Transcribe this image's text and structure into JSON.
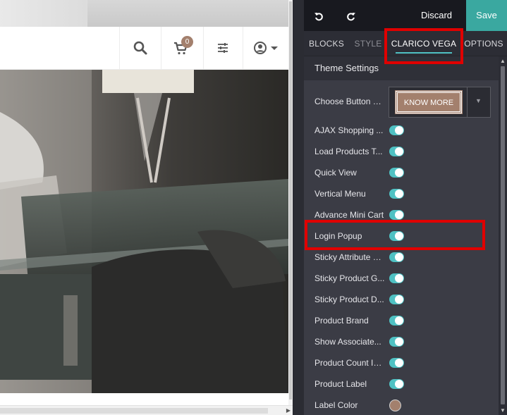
{
  "navbar": {
    "search_icon": "search-icon",
    "cart_icon": "cart-icon",
    "cart_count": "0",
    "filter_icon": "sliders-icon",
    "account_icon": "user-circle-icon",
    "account_caret": "chevron-down-icon"
  },
  "editor": {
    "topbar": {
      "undo_icon": "undo-icon",
      "redo_icon": "redo-icon",
      "discard_label": "Discard",
      "save_label": "Save"
    },
    "tabs": [
      {
        "label": "BLOCKS",
        "state": "inactive"
      },
      {
        "label": "STYLE",
        "state": "inactive"
      },
      {
        "label": "CLARICO VEGA",
        "state": "active"
      },
      {
        "label": "OPTIONS",
        "state": "inactive"
      }
    ],
    "section_title": "Theme Settings",
    "button_style": {
      "label": "Choose Button S...",
      "selected_preview": "KNOW MORE"
    },
    "settings": [
      {
        "label": "AJAX Shopping ...",
        "control": "toggle",
        "on": true
      },
      {
        "label": "Load Products T...",
        "control": "toggle",
        "on": true
      },
      {
        "label": "Quick View",
        "control": "toggle",
        "on": true
      },
      {
        "label": "Vertical Menu",
        "control": "toggle",
        "on": true
      },
      {
        "label": "Advance Mini Cart",
        "control": "toggle",
        "on": true
      },
      {
        "label": "Login Popup",
        "control": "toggle",
        "on": true
      },
      {
        "label": "Sticky Attribute &...",
        "control": "toggle",
        "on": true
      },
      {
        "label": "Sticky Product G...",
        "control": "toggle",
        "on": true
      },
      {
        "label": "Sticky Product D...",
        "control": "toggle",
        "on": true
      },
      {
        "label": "Product Brand",
        "control": "toggle",
        "on": true
      },
      {
        "label": "Show Associate...",
        "control": "toggle",
        "on": true
      },
      {
        "label": "Product Count In...",
        "control": "toggle",
        "on": true
      },
      {
        "label": "Product Label",
        "control": "toggle",
        "on": true
      },
      {
        "label": "Label Color",
        "control": "color",
        "value": "#a3806d"
      }
    ]
  },
  "colors": {
    "accent_teal": "#4fc1c3",
    "save_bg": "#3aa8a0",
    "brand_brown": "#a3806d",
    "highlight_red": "#e00000",
    "panel_bg": "#3b3c45",
    "topbar_bg": "#18191f"
  }
}
